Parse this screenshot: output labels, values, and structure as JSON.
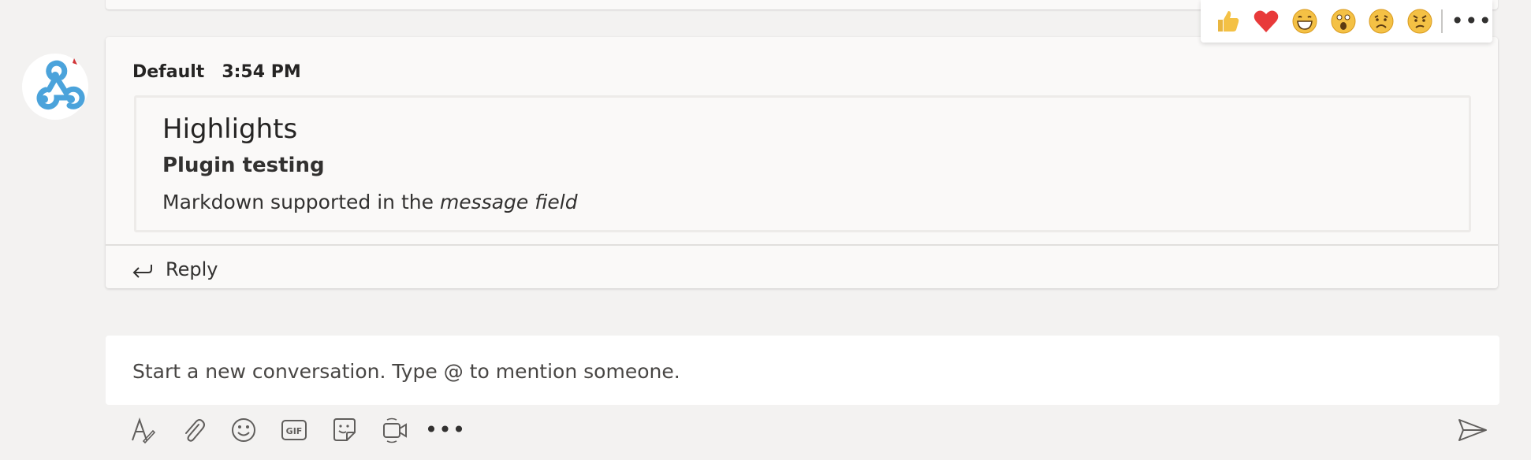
{
  "message": {
    "sender": "Default",
    "time": "3:54 PM",
    "card": {
      "title": "Highlights",
      "subtitle": "Plugin testing",
      "text_plain": "Markdown supported in the ",
      "text_italic": "message field"
    },
    "reply_label": "Reply"
  },
  "reactions": {
    "items": [
      {
        "name": "like",
        "icon": "thumbs-up-icon"
      },
      {
        "name": "heart",
        "icon": "heart-icon"
      },
      {
        "name": "laugh",
        "icon": "laugh-icon"
      },
      {
        "name": "surprised",
        "icon": "surprised-icon"
      },
      {
        "name": "sad",
        "icon": "sad-icon"
      },
      {
        "name": "angry",
        "icon": "angry-icon"
      }
    ],
    "more": "•••"
  },
  "compose": {
    "placeholder": "Start a new conversation. Type @ to mention someone."
  },
  "toolbar": {
    "items": [
      "format-icon",
      "attach-icon",
      "emoji-icon",
      "gif-icon",
      "sticker-icon",
      "meet-now-icon"
    ],
    "more": "•••",
    "gif_label": "GIF"
  },
  "colors": {
    "background": "#f3f2f1",
    "card": "#faf9f8",
    "avatar_accent": "#4ba3db",
    "heart": "#e83a3a",
    "emoji_yellow": "#f4c145"
  }
}
